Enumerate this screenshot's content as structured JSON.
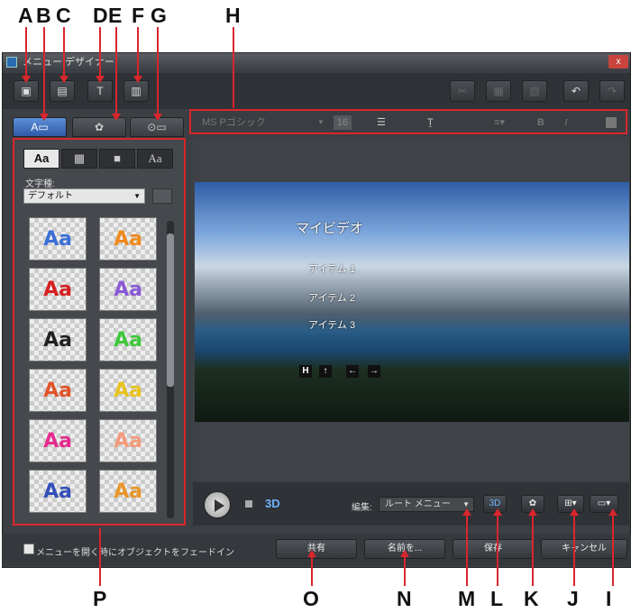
{
  "callouts": {
    "top": [
      "A",
      "B",
      "C",
      "D",
      "E",
      "F",
      "G",
      "H"
    ],
    "bottom": [
      "P",
      "O",
      "N",
      "M",
      "L",
      "K",
      "J",
      "I"
    ]
  },
  "window": {
    "title": "メニュー デザイナー",
    "close": "x"
  },
  "font_toolbar": {
    "font": "MS Pゴシック",
    "size": "16",
    "bold": "B",
    "italic": "I"
  },
  "left_panel": {
    "subtabs": [
      "Aa",
      "",
      "",
      "Aa"
    ],
    "font_label": "文字種:",
    "font_value": "デフォルト",
    "styles": [
      "Aa",
      "Aa",
      "Aa",
      "Aa",
      "Aa",
      "Aa",
      "Aa",
      "Aa",
      "Aa",
      "Aa",
      "Aa",
      "Aa"
    ]
  },
  "preview": {
    "title": "マイビデオ",
    "items": [
      "アイテム 1",
      "アイテム 2",
      "アイテム 3"
    ],
    "nav_buttons": [
      "H",
      "↑",
      "←",
      "→"
    ]
  },
  "controls": {
    "mode_3d": "3D",
    "edit_label": "編集:",
    "root_menu": "ルート メニュー"
  },
  "bottom": {
    "fade_label": "メニューを開く時にオブジェクトをフェードイン",
    "share": "共有",
    "save_as": "名前を...",
    "save": "保存",
    "cancel": "キャンセル"
  },
  "colors": {
    "callout_red": "#d9262c",
    "active_tab": "#2e5aa6",
    "window_bg": "#3c3f43"
  }
}
